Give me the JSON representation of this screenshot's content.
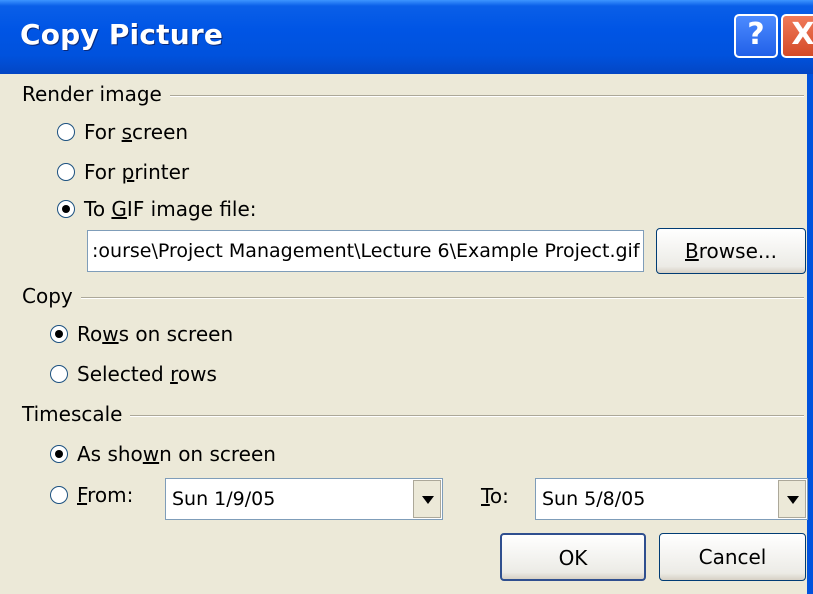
{
  "dialog": {
    "title": "Copy Picture",
    "help_glyph": "?",
    "close_glyph": "X"
  },
  "render_image": {
    "label": "Render image",
    "options": [
      {
        "pre": "For ",
        "ul": "s",
        "post": "creen",
        "checked": false
      },
      {
        "pre": "For ",
        "ul": "p",
        "post": "rinter",
        "checked": false
      },
      {
        "pre": "To ",
        "ul": "G",
        "post": "IF image file:",
        "checked": true
      }
    ],
    "file_path": ":ourse\\Project Management\\Lecture 6\\Example Project.gif",
    "browse": {
      "ul": "B",
      "post": "rowse..."
    }
  },
  "copy": {
    "label": "Copy",
    "options": [
      {
        "pre": "Ro",
        "ul": "w",
        "post": "s on screen",
        "checked": true
      },
      {
        "pre": "Selected ",
        "ul": "r",
        "post": "ows",
        "checked": false
      }
    ]
  },
  "timescale": {
    "label": "Timescale",
    "options": [
      {
        "pre": "As sho",
        "ul": "w",
        "post": "n on screen",
        "checked": true
      },
      {
        "pre": "",
        "ul": "F",
        "post": "rom:",
        "checked": false
      }
    ],
    "from_value": "Sun 1/9/05",
    "to_label": {
      "ul": "T",
      "post": "o:"
    },
    "to_value": "Sun 5/8/05"
  },
  "buttons": {
    "ok": "OK",
    "cancel": "Cancel"
  }
}
